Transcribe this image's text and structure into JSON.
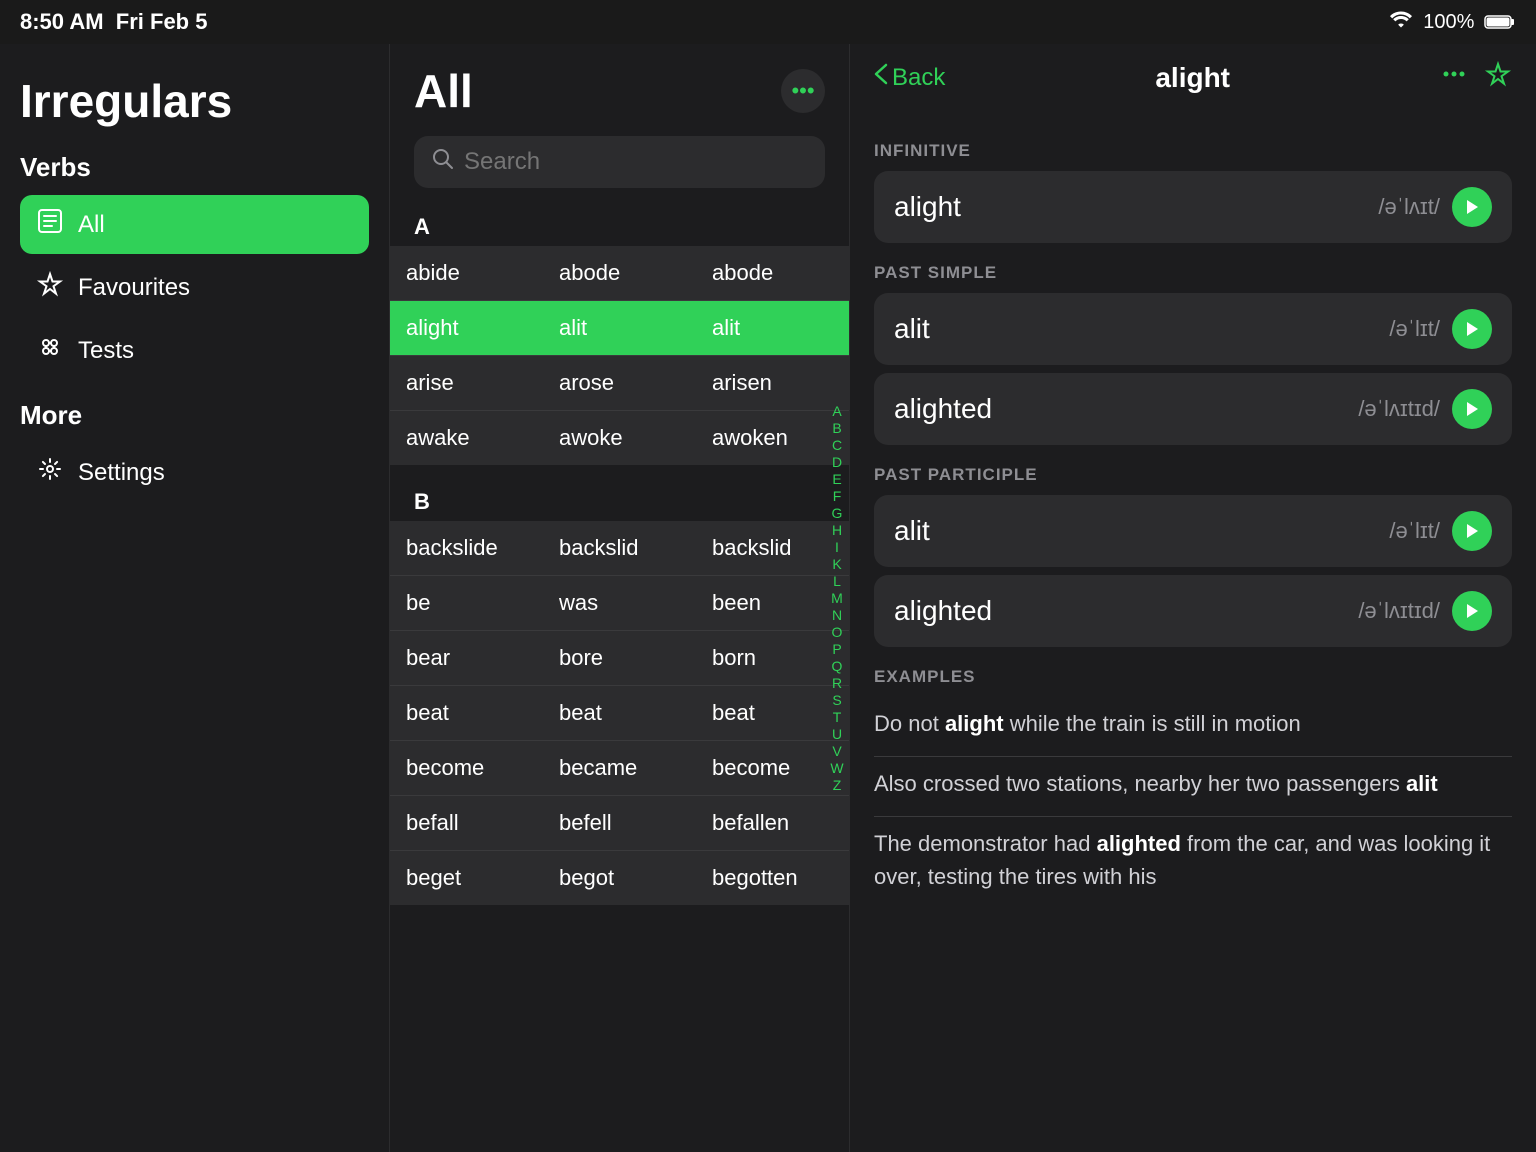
{
  "statusBar": {
    "time": "8:50 AM",
    "date": "Fri Feb 5",
    "wifi": "wifi-icon",
    "battery": "100%"
  },
  "sidebar": {
    "title": "Irregulars",
    "verbsLabel": "Verbs",
    "items": [
      {
        "id": "all",
        "label": "All",
        "icon": "📖",
        "active": true
      },
      {
        "id": "favourites",
        "label": "Favourites",
        "icon": "⭐",
        "active": false
      },
      {
        "id": "tests",
        "label": "Tests",
        "icon": "🧩",
        "active": false
      }
    ],
    "moreLabel": "More",
    "moreItems": [
      {
        "id": "settings",
        "label": "Settings",
        "icon": "⚙️"
      }
    ]
  },
  "middlePanel": {
    "title": "All",
    "moreButton": "•••",
    "search": {
      "placeholder": "Search"
    },
    "sections": [
      {
        "letter": "A",
        "verbs": [
          {
            "base": "abide",
            "past": "abode",
            "participle": "abode",
            "selected": false
          },
          {
            "base": "alight",
            "past": "alit",
            "participle": "alit",
            "selected": true
          },
          {
            "base": "arise",
            "past": "arose",
            "participle": "arisen",
            "selected": false
          },
          {
            "base": "awake",
            "past": "awoke",
            "participle": "awoken",
            "selected": false
          }
        ]
      },
      {
        "letter": "B",
        "verbs": [
          {
            "base": "backslide",
            "past": "backslid",
            "participle": "backslid",
            "selected": false
          },
          {
            "base": "be",
            "past": "was",
            "participle": "been",
            "selected": false
          },
          {
            "base": "bear",
            "past": "bore",
            "participle": "born",
            "selected": false
          },
          {
            "base": "beat",
            "past": "beat",
            "participle": "beat",
            "selected": false
          },
          {
            "base": "become",
            "past": "became",
            "participle": "become",
            "selected": false
          },
          {
            "base": "befall",
            "past": "befell",
            "participle": "befallen",
            "selected": false
          },
          {
            "base": "beget",
            "past": "begot",
            "participle": "begotten",
            "selected": false
          }
        ]
      }
    ],
    "alphabetIndex": [
      "A",
      "B",
      "C",
      "D",
      "E",
      "F",
      "G",
      "H",
      "I",
      "K",
      "L",
      "M",
      "N",
      "O",
      "P",
      "Q",
      "R",
      "S",
      "T",
      "U",
      "V",
      "W",
      "Z"
    ]
  },
  "detailPanel": {
    "backLabel": "Back",
    "title": "alight",
    "moreButton": "•••",
    "favoriteButton": "★",
    "sections": {
      "infinitive": {
        "label": "INFINITIVE",
        "forms": [
          {
            "word": "alight",
            "pronunciation": "/əˈlʌɪt/"
          }
        ]
      },
      "pastSimple": {
        "label": "PAST SIMPLE",
        "forms": [
          {
            "word": "alit",
            "pronunciation": "/əˈlɪt/"
          },
          {
            "word": "alighted",
            "pronunciation": "/əˈlʌɪtɪd/"
          }
        ]
      },
      "pastParticiple": {
        "label": "PAST PARTICIPLE",
        "forms": [
          {
            "word": "alit",
            "pronunciation": "/əˈlɪt/"
          },
          {
            "word": "alighted",
            "pronunciation": "/əˈlʌɪtɪd/"
          }
        ]
      },
      "examples": {
        "label": "EXAMPLES",
        "sentences": [
          {
            "text": "Do not ",
            "bold": "alight",
            "rest": " while the train is still in motion"
          },
          {
            "text": "Also crossed two stations, nearby her two passengers ",
            "bold": "alit",
            "rest": ""
          },
          {
            "text": "The demonstrator had ",
            "bold": "alighted",
            "rest": " from the car, and was looking it over, testing the tires with his"
          }
        ]
      }
    }
  }
}
